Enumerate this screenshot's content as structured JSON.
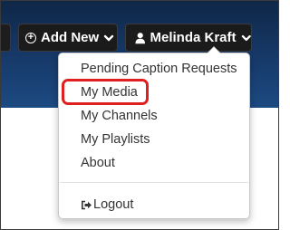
{
  "header": {
    "add_new_label": "Add New",
    "user_name": "Melinda Kraft"
  },
  "user_menu": {
    "items": [
      {
        "label": "Pending Caption Requests"
      },
      {
        "label": "My Media"
      },
      {
        "label": "My Channels"
      },
      {
        "label": "My Playlists"
      },
      {
        "label": "About"
      }
    ],
    "logout_label": "Logout"
  },
  "annotation": {
    "highlighted_item": "My Media",
    "highlight_color": "#e02020"
  },
  "colors": {
    "navbar": "#173a6a",
    "button_bg": "#1b1b1b",
    "menu_text": "#333333"
  },
  "icons": {
    "add_new": "plus-circle-icon",
    "caret": "chevron-down-icon",
    "user": "user-icon",
    "logout": "sign-out-icon"
  }
}
